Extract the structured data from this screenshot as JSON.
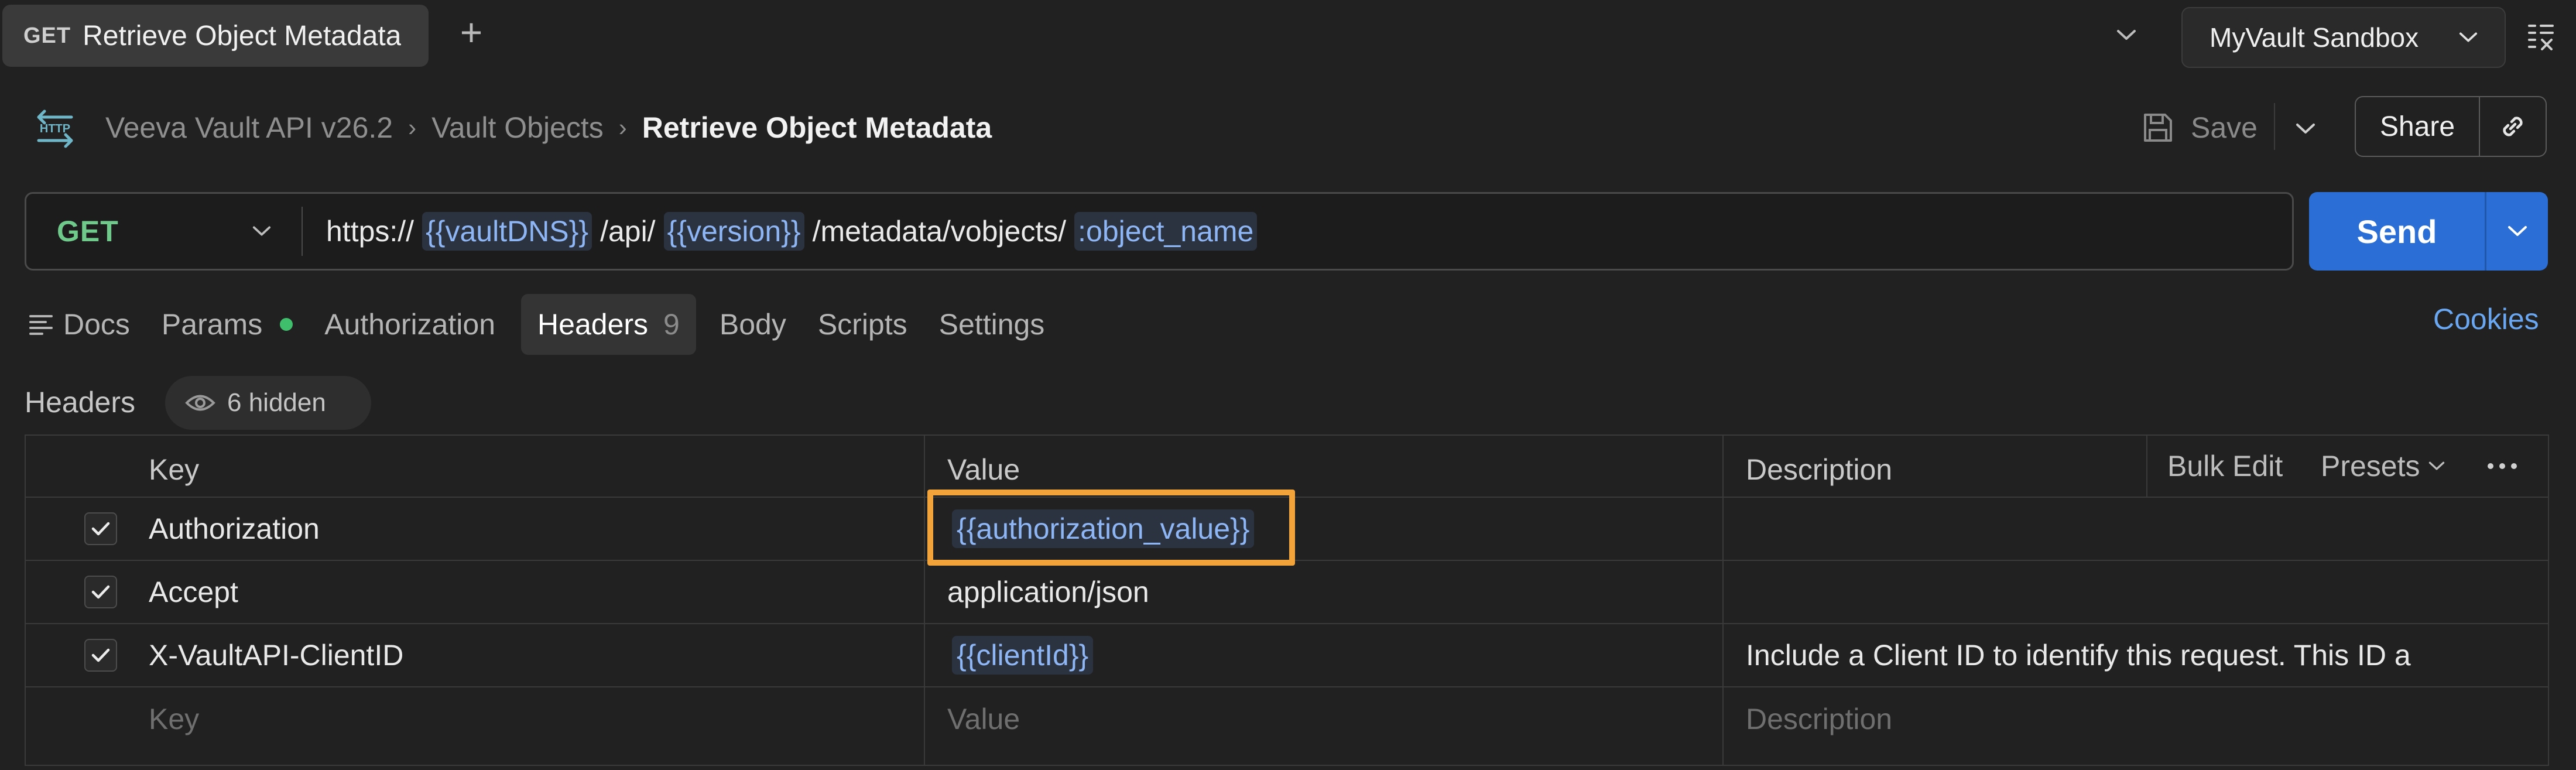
{
  "tab": {
    "method": "GET",
    "title": "Retrieve Object Metadata"
  },
  "environment": {
    "name": "MyVault Sandbox"
  },
  "breadcrumb": {
    "collection": "Veeva Vault API v26.2",
    "folder": "Vault Objects",
    "request": "Retrieve Object Metadata"
  },
  "toolbar": {
    "save_label": "Save",
    "share_label": "Share"
  },
  "request": {
    "method": "GET",
    "url_parts": {
      "p1": "https://",
      "v1": "{{vaultDNS}}",
      "p2": "/api/",
      "v2": "{{version}}",
      "p3": "/metadata/vobjects/",
      "v3": ":object_name"
    },
    "send_label": "Send"
  },
  "req_tabs": {
    "docs": "Docs",
    "params": "Params",
    "authorization": "Authorization",
    "headers": "Headers",
    "headers_count": "9",
    "body": "Body",
    "scripts": "Scripts",
    "settings": "Settings",
    "cookies": "Cookies"
  },
  "headers_section": {
    "title": "Headers",
    "hidden_label": "6 hidden"
  },
  "table": {
    "columns": {
      "key": "Key",
      "value": "Value",
      "description": "Description"
    },
    "actions": {
      "bulk_edit": "Bulk Edit",
      "presets": "Presets"
    },
    "rows": [
      {
        "key": "Authorization",
        "value": "{{authorization_value}}",
        "description": "",
        "checked": true
      },
      {
        "key": "Accept",
        "value": "application/json",
        "description": "",
        "checked": true
      },
      {
        "key": "X-VaultAPI-ClientID",
        "value": "{{clientId}}",
        "description": "Include a Client ID to identify this request. This ID a",
        "checked": true
      }
    ],
    "placeholder": {
      "key": "Key",
      "value": "Value",
      "description": "Description"
    }
  },
  "colors": {
    "accent": "#2b6fd6",
    "method_get": "#6ec98a",
    "variable": "#8eb6f5",
    "highlight": "#f2a33a",
    "link": "#6aa7f2"
  }
}
